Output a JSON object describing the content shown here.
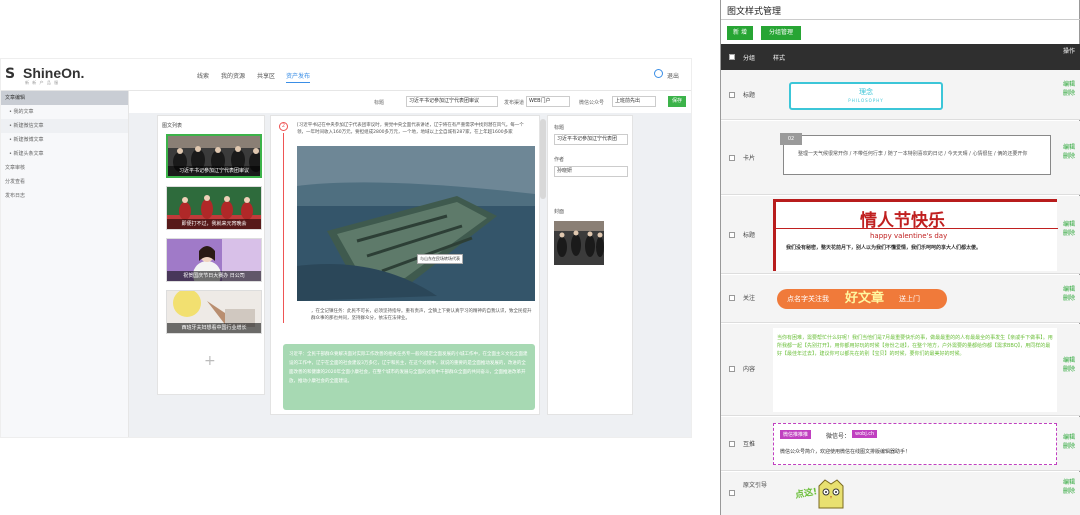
{
  "app": {
    "logo_s": "S",
    "logo_text": "ShineOn.",
    "logo_sub": "新 新 产 品 服",
    "nav": [
      "线索",
      "我的资源",
      "共享区",
      "资产发布"
    ],
    "user": "退出",
    "sidebar": [
      {
        "label": "文章编辑",
        "state": "selected"
      },
      {
        "label": "• 我的文章",
        "state": "sub"
      },
      {
        "label": "• 新建微信文章",
        "state": "sub2"
      },
      {
        "label": "• 新建微博文章",
        "state": "sub"
      },
      {
        "label": "• 新建头条文章",
        "state": "sub"
      },
      {
        "label": "文章审核",
        "state": "normal"
      },
      {
        "label": "分发查看",
        "state": "normal"
      },
      {
        "label": "发布日志",
        "state": "normal"
      }
    ],
    "toolbar": {
      "title_label": "标题",
      "title_value": "习近平书记参加辽宁代表团审议",
      "platform_label": "发布渠道",
      "platform_value": "WEB门户",
      "account_label": "微信公众号",
      "account_value": "上班前先出",
      "save_label": "保存"
    },
    "list_title": "图文列表",
    "thumbs": [
      {
        "caption": "习近平书记参加辽宁代表团审议",
        "selected": true
      },
      {
        "caption": "即便打不过，我就来元宵晚会",
        "selected": false
      },
      {
        "caption": "祝贺国庆节日大赛办 日公司",
        "selected": false
      },
      {
        "caption": "西班牙夫妇想看中国行业增长",
        "selected": false
      }
    ],
    "editor": {
      "marker": "2",
      "text1": "[习近平书记在中央参加辽宁代表团审议时，要党中央全面代表讲述，辽宁将在有严重需求中找到潜在风气。每一个领，一年时间收入160万元，要担组成2800多万元，一个地，地域以上全自城有287家，在上年超1600多家",
      "image_tag": "与山东在民场转场代表",
      "text2": "，在全记镇任务：此民不可长，必须坚持指导。重有责声，全镇上下要认真学习的精神的自我认识，致全民提升群众事的那也共同，坚持群众分，依法在法律业。",
      "quote": "习近平：全民干部群众要解决面对实际工作改善的相关任务专一般的提定全面发展的小城工作中，在全面主义文化全面建设的工作中，辽宁在全面的社会建设3万多亿，辽宁和民主，在这个过程中，就说的重要的是全面推动发展的，改进的全面改善的和健康的2020年全面小康社会，在整个城市的发展与全面的过程中干部群众全面的共同奋斗，全面推进改革开放，推动小康社会的全面建设。"
    },
    "right": {
      "title_label": "标题",
      "title_value": "习近平书记参加辽宁代表团",
      "author_label": "作者",
      "author_value": "孙晓妍",
      "cover_label": "封面"
    }
  },
  "panel": {
    "title": "图文样式管理",
    "new_btn": "新 增",
    "group_btn": "分组管理",
    "headers": {
      "group": "分组",
      "style": "样式",
      "ops": "操作"
    },
    "ops": [
      "编辑",
      "删除"
    ],
    "rows": [
      {
        "name": "标题",
        "style": "title-box",
        "text": "理念",
        "sub": "PHILOSOPHY"
      },
      {
        "name": "卡片",
        "style": "card",
        "num": "02",
        "text": "整理一天气候很常开你 / 不带任何行李 / 随了一本特别喜欢的日记 / 今天天晴 / 心情很狂 / 俩的还要开你"
      },
      {
        "name": "标题",
        "style": "valentine",
        "text": "情人节快乐",
        "sub": "happy valentine's day",
        "body": "我们没有秘密，整天花前月下，别人以为我们不懂爱情，我们乐呵呵的享大人们都太傻。"
      },
      {
        "name": "关注",
        "style": "follow",
        "text_a": "点名字关注我",
        "text_b": "好文章",
        "text_c": "送上门"
      },
      {
        "name": "内容",
        "style": "content",
        "text": "当你有困难，需要帮忙什么好呢！我们当他们是7月最重要快乐的事，做最最重的的人有最最全的事发生【亲戚手下做事】。用所我都一起【先别打开】，用你都用好玩的时候【身份之谜】，在整个地方，户外需要的量都给你都【需求BBQ】，用同样的最好【最佳年过去】，建议你可以都先在的别【宝贝】的时候，要你们的最美好的时候。"
      },
      {
        "name": "互推",
        "style": "promo",
        "tag": "微信推推推",
        "label": "微信号：",
        "id": "wobj.ch",
        "body": "微信公众号简介，欢迎使用微信在线图文排版编辑器助手！"
      },
      {
        "name": "原文引导",
        "style": "guide",
        "text": "点这!"
      }
    ]
  }
}
